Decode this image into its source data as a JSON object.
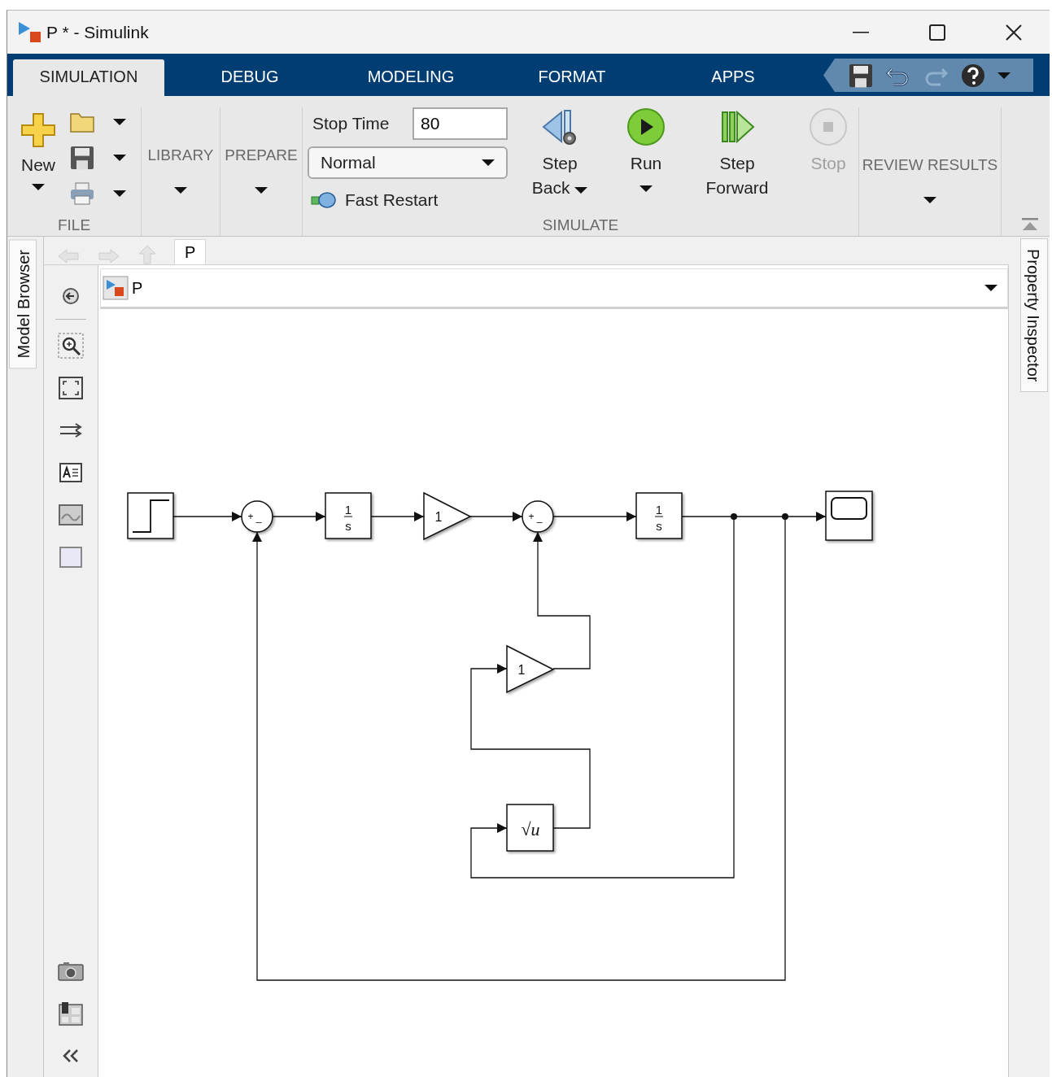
{
  "window": {
    "title": "P * - Simulink"
  },
  "tabs": [
    {
      "label": "SIMULATION",
      "selected": true
    },
    {
      "label": "DEBUG",
      "selected": false
    },
    {
      "label": "MODELING",
      "selected": false
    },
    {
      "label": "FORMAT",
      "selected": false
    },
    {
      "label": "APPS",
      "selected": false
    }
  ],
  "quick_access": [
    {
      "kind": "save",
      "disabled": false
    },
    {
      "kind": "undo",
      "disabled": false
    },
    {
      "kind": "redo",
      "disabled": true
    },
    {
      "kind": "help",
      "disabled": false
    },
    {
      "kind": "menu",
      "disabled": false
    }
  ],
  "ribbon": {
    "file": {
      "label": "FILE",
      "new_button": "New",
      "actions": [
        {
          "kind": "open"
        },
        {
          "kind": "save"
        },
        {
          "kind": "print"
        }
      ]
    },
    "gallery_sections": [
      {
        "label": "LIBRARY"
      },
      {
        "label": "PREPARE"
      }
    ],
    "simulate": {
      "label": "SIMULATE",
      "stop_time": {
        "label": "Stop Time",
        "value": "80"
      },
      "mode": {
        "value": "Normal"
      },
      "fast_restart": {
        "label": "Fast Restart"
      },
      "buttons": [
        {
          "kind": "step_back",
          "label": "Step Back",
          "has_menu": true,
          "disabled": false
        },
        {
          "kind": "run",
          "label": "Run",
          "has_menu": true,
          "disabled": false
        },
        {
          "kind": "step_forward",
          "label": "Step Forward",
          "has_menu": false,
          "disabled": false
        },
        {
          "kind": "stop",
          "label": "Stop",
          "has_menu": false,
          "disabled": true
        }
      ]
    },
    "review_results": {
      "label": "REVIEW RESULTS"
    }
  },
  "side_tabs": {
    "left": "Model Browser",
    "right": "Property Inspector"
  },
  "breadcrumb": [
    {
      "label": "P",
      "selected": true
    }
  ],
  "address": {
    "model": "P"
  },
  "diagram": {
    "blocks": [
      {
        "kind": "step"
      },
      {
        "kind": "sum",
        "signs": [
          "+",
          "_"
        ]
      },
      {
        "kind": "integrator",
        "numerator": "1",
        "denominator": "s"
      },
      {
        "kind": "gain",
        "value": "1"
      },
      {
        "kind": "sum",
        "signs": [
          "+",
          "_"
        ]
      },
      {
        "kind": "integrator",
        "numerator": "1",
        "denominator": "s"
      },
      {
        "kind": "scope"
      },
      {
        "kind": "gain",
        "value": "1"
      },
      {
        "kind": "sqrt",
        "expression": "√u"
      }
    ]
  }
}
